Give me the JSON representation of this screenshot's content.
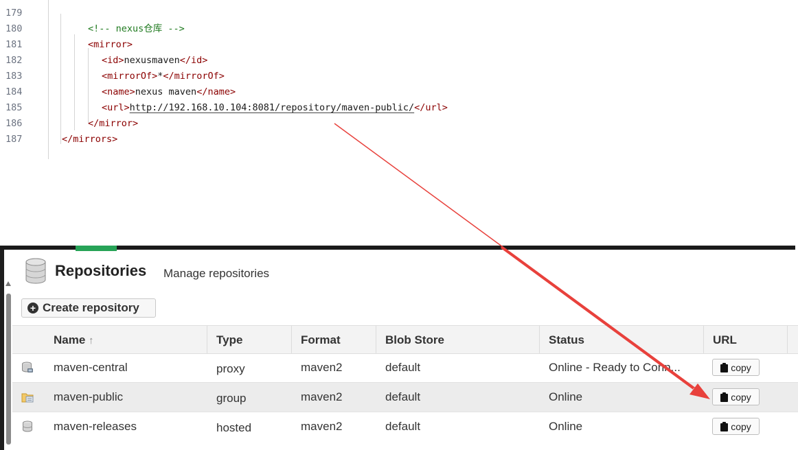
{
  "code": {
    "lines": [
      {
        "n": "179",
        "parts": []
      },
      {
        "n": "180",
        "parts": [
          {
            "cls": "cmt",
            "t": "<!-- nexus仓库 -->"
          }
        ]
      },
      {
        "n": "181",
        "parts": [
          {
            "cls": "tag",
            "t": "<mirror>"
          }
        ]
      },
      {
        "n": "182",
        "parts": [
          {
            "cls": "tag",
            "t": "<id>"
          },
          {
            "cls": "val",
            "t": "nexusmaven"
          },
          {
            "cls": "tag",
            "t": "</id>"
          }
        ]
      },
      {
        "n": "183",
        "parts": [
          {
            "cls": "tag",
            "t": "<mirrorOf>"
          },
          {
            "cls": "val",
            "t": "*"
          },
          {
            "cls": "tag",
            "t": "</mirrorOf>"
          }
        ]
      },
      {
        "n": "184",
        "parts": [
          {
            "cls": "tag",
            "t": "<name>"
          },
          {
            "cls": "val",
            "t": "nexus maven"
          },
          {
            "cls": "tag",
            "t": "</name>"
          }
        ]
      },
      {
        "n": "185",
        "parts": [
          {
            "cls": "tag",
            "t": "<url>"
          },
          {
            "cls": "val url-ul",
            "t": "http://192.168.10.104:8081/repository/maven-public/"
          },
          {
            "cls": "tag",
            "t": "</url>"
          }
        ]
      },
      {
        "n": "186",
        "parts": [
          {
            "cls": "tag",
            "t": "</mirror>"
          }
        ]
      },
      {
        "n": "187",
        "parts": [
          {
            "cls": "tag",
            "t": "</mirrors>"
          }
        ]
      }
    ]
  },
  "header": {
    "title": "Repositories",
    "subtitle": "Manage repositories"
  },
  "toolbar": {
    "create_label": "Create repository",
    "create_icon": "plus-circle-icon"
  },
  "table": {
    "columns": [
      {
        "key": "name",
        "label": "Name",
        "sort": "↑"
      },
      {
        "key": "type",
        "label": "Type"
      },
      {
        "key": "format",
        "label": "Format"
      },
      {
        "key": "blob",
        "label": "Blob Store"
      },
      {
        "key": "status",
        "label": "Status"
      },
      {
        "key": "url",
        "label": "URL"
      }
    ],
    "copy_label": "copy",
    "rows": [
      {
        "icon": "proxy-repo-icon",
        "name": "maven-central",
        "type": "proxy",
        "format": "maven2",
        "blob": "default",
        "status": "Online - Ready to Conn..."
      },
      {
        "icon": "group-repo-icon",
        "name": "maven-public",
        "type": "group",
        "format": "maven2",
        "blob": "default",
        "status": "Online"
      },
      {
        "icon": "hosted-repo-icon",
        "name": "maven-releases",
        "type": "hosted",
        "format": "maven2",
        "blob": "default",
        "status": "Online"
      }
    ]
  },
  "colors": {
    "arrow": "#e8413c",
    "accent_green": "#27a357",
    "tag": "#8b0000",
    "comment": "#1f7a1f"
  }
}
